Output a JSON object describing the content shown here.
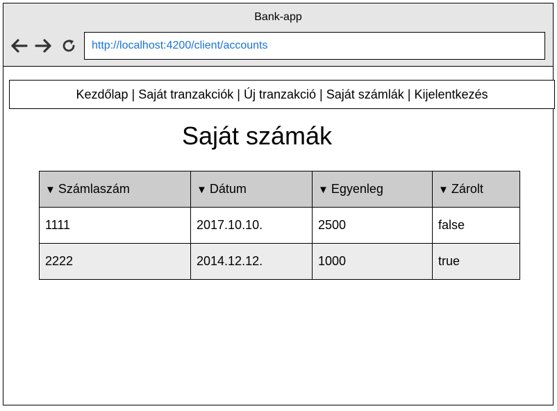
{
  "window": {
    "title": "Bank-app"
  },
  "browser": {
    "url": "http://localhost:4200/client/accounts",
    "icons": {
      "back": "arrow-left-icon",
      "forward": "arrow-right-icon",
      "reload": "reload-icon"
    }
  },
  "menu": {
    "items": [
      "Kezdőlap",
      "Saját tranzakciók",
      "Új tranzakció",
      "Saját számlák",
      "Kijelentkezés"
    ],
    "separator": "|"
  },
  "page": {
    "title": "Saját számák"
  },
  "table": {
    "sort_glyph": "▼",
    "columns": [
      "Számlaszám",
      "Dátum",
      "Egyenleg",
      "Zárolt"
    ],
    "rows": [
      [
        "1111",
        "2017.10.10.",
        "2500",
        "false"
      ],
      [
        "2222",
        "2014.12.12.",
        "1000",
        "true"
      ]
    ]
  },
  "colors": {
    "titlebar": "#e6e6e6",
    "url_text": "#1a73d9",
    "header_bg": "#cccccc",
    "alt_row_bg": "#ececec"
  }
}
